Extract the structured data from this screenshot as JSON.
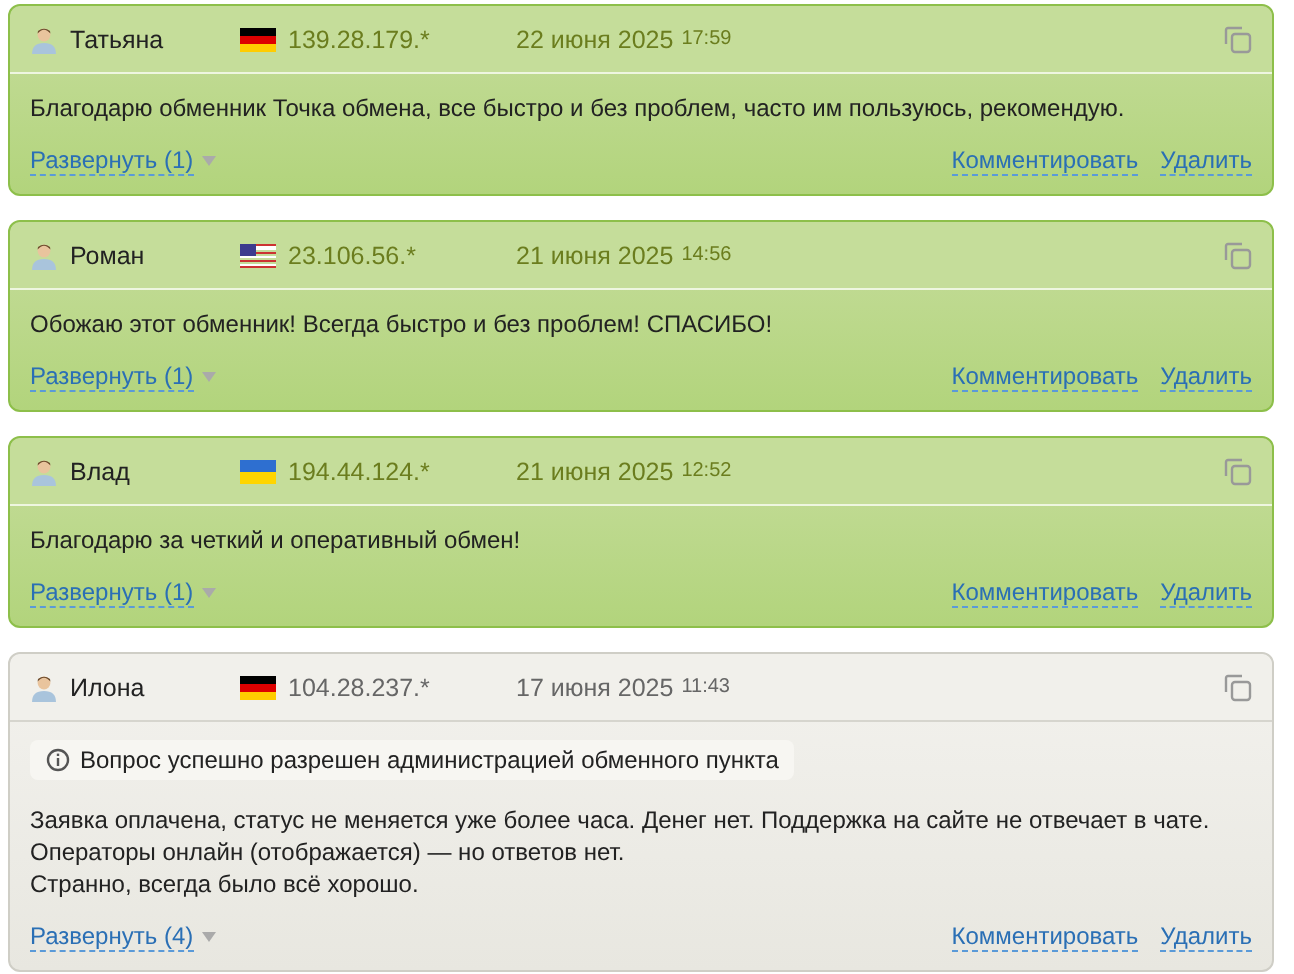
{
  "reviews": [
    {
      "kind": "positive",
      "author": "Татьяна",
      "flag": {
        "kind": "de"
      },
      "ip": "139.28.179.*",
      "date": "22 июня 2025",
      "time": "17:59",
      "text": [
        "Благодарю обменник Точка обмена, все быстро и без проблем, часто им пользуюсь, рекомендую."
      ],
      "expand": "Развернуть (1)",
      "comment": "Комментировать",
      "delete": "Удалить"
    },
    {
      "kind": "positive",
      "author": "Роман",
      "flag": {
        "kind": "us"
      },
      "ip": "23.106.56.*",
      "date": "21 июня 2025",
      "time": "14:56",
      "text": [
        "Обожаю этот обменник! Всегда быстро и без проблем! СПАСИБО!"
      ],
      "expand": "Развернуть (1)",
      "comment": "Комментировать",
      "delete": "Удалить"
    },
    {
      "kind": "positive",
      "author": "Влад",
      "flag": {
        "kind": "ua"
      },
      "ip": "194.44.124.*",
      "date": "21 июня 2025",
      "time": "12:52",
      "text": [
        "Благодарю за четкий и оперативный обмен!"
      ],
      "expand": "Развернуть (1)",
      "comment": "Комментировать",
      "delete": "Удалить"
    },
    {
      "kind": "neutral",
      "author": "Илона",
      "flag": {
        "kind": "de"
      },
      "ip": "104.28.237.*",
      "date": "17 июня 2025",
      "time": "11:43",
      "notice": "Вопрос успешно разрешен администрацией обменного пункта",
      "text": [
        "Заявка оплачена, статус не меняется уже более часа. Денег нет. Поддержка на сайте не отвечает в чате.",
        "Операторы онлайн (отображается) — но ответов нет.",
        "Странно, всегда было всё хорошо."
      ],
      "expand": "Развернуть (4)",
      "comment": "Комментировать",
      "delete": "Удалить"
    }
  ]
}
